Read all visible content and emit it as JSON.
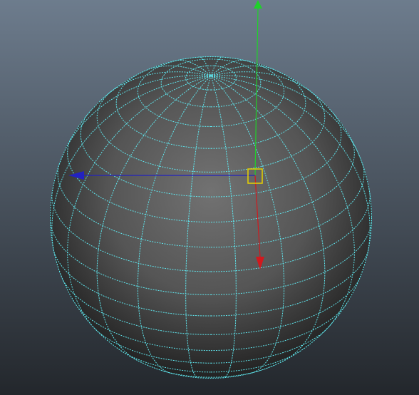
{
  "viewport": {
    "background_top": "#6d7c8d",
    "background_bottom": "#23272c"
  },
  "object": {
    "type": "polygon-sphere",
    "display_mode": "smooth-shaded",
    "selected": true,
    "wireframe_color": "#5fe6ee",
    "surface_light": "#727272",
    "surface_dark": "#222222",
    "latitude_divisions": 20,
    "longitude_divisions": 20
  },
  "manipulator": {
    "tool": "move",
    "pivot_color": "#e8d200",
    "axes": [
      {
        "axis": "y",
        "color": "#1fd12a",
        "icon": "y-axis-arrow-icon"
      },
      {
        "axis": "x",
        "color": "#d1191e",
        "icon": "x-axis-arrow-icon"
      },
      {
        "axis": "z",
        "color": "#2222c0",
        "icon": "z-axis-arrow-icon"
      }
    ]
  }
}
